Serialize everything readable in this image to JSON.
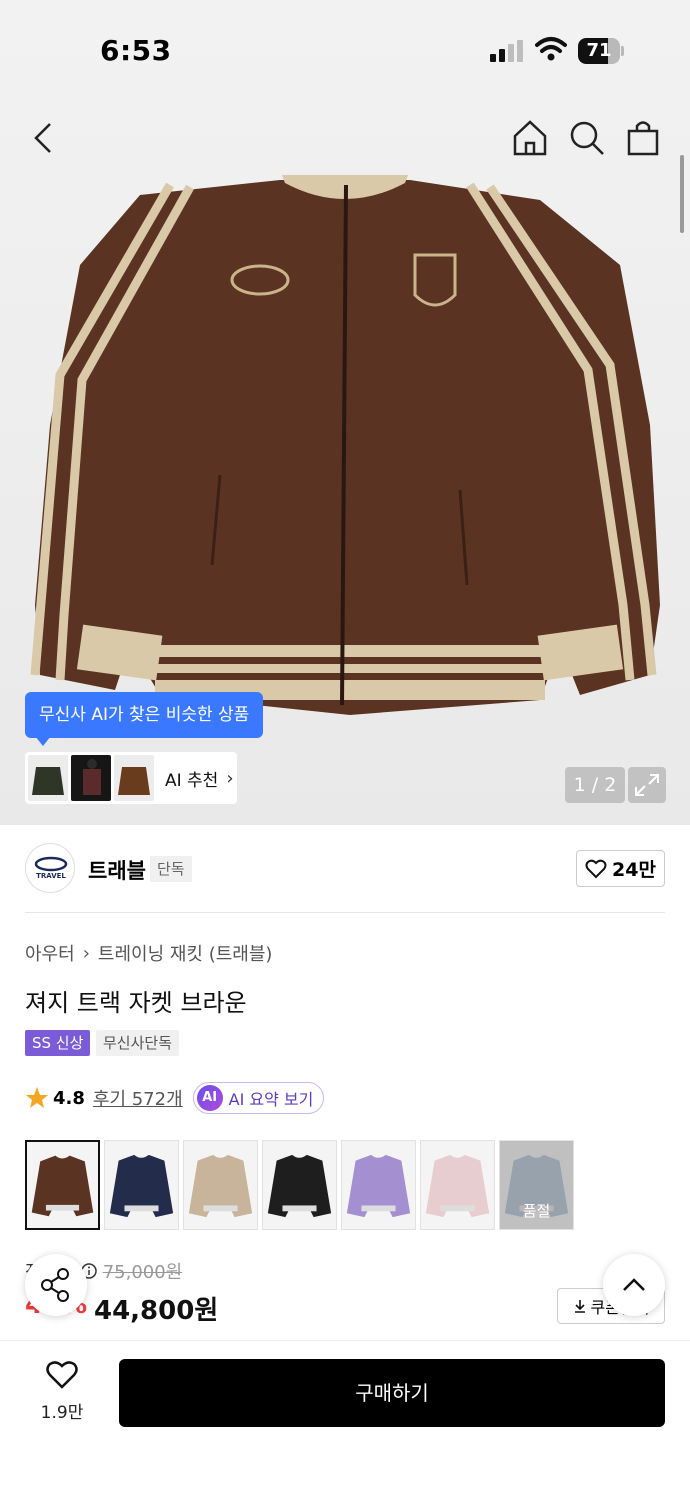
{
  "status_bar": {
    "time": "6:53",
    "battery": "71",
    "battery_level": 0.71,
    "icons": [
      "signal-icon",
      "wifi-icon",
      "battery-icon"
    ]
  },
  "nav": {
    "icons": [
      "back-icon",
      "home-icon",
      "search-icon",
      "cart-icon"
    ]
  },
  "hero": {
    "ai_bubble": "무신사 AI가 찾은 비슷한 상품",
    "ai_rec_label": "AI 추천",
    "page_indicator": "1 / 2"
  },
  "brand": {
    "name": "트래블",
    "tag": "단독",
    "likes": "24만",
    "logo_text": "TRAVEL"
  },
  "breadcrumb": {
    "category": "아우터",
    "subcategory": "트레이닝 재킷 (트래블)"
  },
  "product": {
    "title": "져지 트랙 자켓 브라운",
    "badge_ss": "SS 신상",
    "badge_exclusive": "무신사단독",
    "rating": "4.8",
    "reviews": "후기 572개",
    "ai_summary": "AI 요약 보기",
    "ai_mark": "AI",
    "variants": [
      {
        "color": "#5a3322",
        "selected": true
      },
      {
        "color": "#232c4a",
        "selected": false
      },
      {
        "color": "#c7b49a",
        "selected": false
      },
      {
        "color": "#1e1e1e",
        "selected": false
      },
      {
        "color": "#a48fd0",
        "selected": false
      },
      {
        "color": "#e8cdd0",
        "selected": false
      },
      {
        "color": "#9ab2c8",
        "selected": false,
        "soldout": true,
        "soldout_label": "품절"
      }
    ]
  },
  "pricing": {
    "label": "정상가",
    "original": "75,000원",
    "discount": "40%",
    "price": "44,800원",
    "coupon": "쿠폰받기"
  },
  "bottom": {
    "wish_count": "1.9만",
    "buy_label": "구매하기"
  },
  "colors": {
    "jacket": "#5b3322",
    "stripe": "#d9c9a8",
    "ai_blue": "#3a79ff",
    "ss_purple": "#7b5cd6",
    "discount_red": "#f03b3b"
  }
}
